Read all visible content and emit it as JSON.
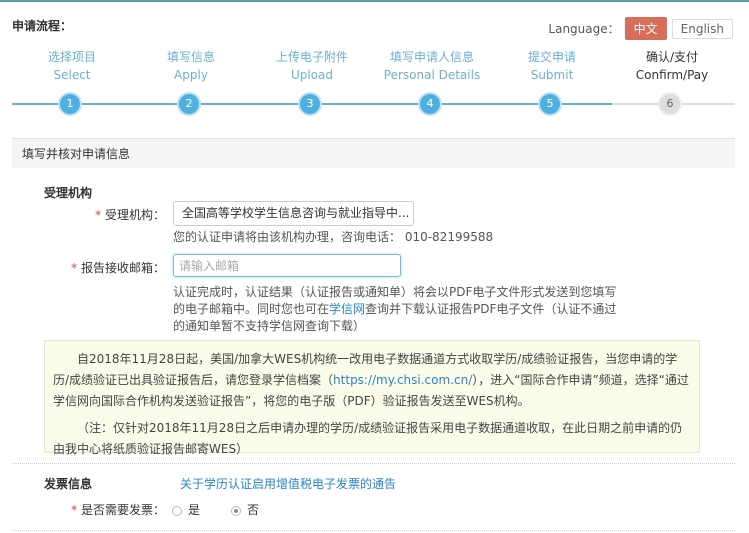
{
  "header": {
    "title": "申请流程：",
    "language_label": "Language：",
    "lang_zh": "中文",
    "lang_en": "English"
  },
  "steps": [
    {
      "zh": "选择项目",
      "en": "Select",
      "num": "1"
    },
    {
      "zh": "填写信息",
      "en": "Apply",
      "num": "2"
    },
    {
      "zh": "上传电子附件",
      "en": "Upload",
      "num": "3"
    },
    {
      "zh": "填写申请人信息",
      "en": "Personal Details",
      "num": "4"
    },
    {
      "zh": "提交申请",
      "en": "Submit",
      "num": "5"
    },
    {
      "zh": "确认/支付",
      "en": "Confirm/Pay",
      "num": "6"
    }
  ],
  "section_title": "填写并核对申请信息",
  "agency": {
    "heading": "受理机构",
    "label": "受理机构：",
    "value": "全国高等学校学生信息咨询与就业指导中...",
    "help": "您的认证申请将由该机构办理，咨询电话： 010-82199588"
  },
  "email": {
    "label": "报告接收邮箱：",
    "placeholder": "请输入邮箱",
    "help_a": "认证完成时，认证结果（认证报告或通知单）将会以PDF电子文件形式发送到您填写的电子邮箱中。同时您也可在",
    "help_link": "学信网",
    "help_b": "查询并下载认证报告PDF电子文件（认证不通过的通知单暂不支持学信网查询下载）"
  },
  "notice": {
    "p1_a": "自2018年11月28日起，美国/加拿大WES机构统一改用电子数据通道方式收取学历/成绩验证报告，当您申请的学历/成绩验证已出具验证报告后，请您登录学信档案（",
    "p1_link": "https://my.chsi.com.cn/",
    "p1_b": "），进入“国际合作申请”频道，选择“通过学信网向国际合作机构发送验证报告”，将您的电子版（PDF）验证报告发送至WES机构。",
    "p2": "（注：仅针对2018年11月28日之后申请办理的学历/成绩验证报告采用电子数据通道收取，在此日期之前申请的仍由我中心将纸质验证报告邮寄WES）"
  },
  "invoice": {
    "heading": "发票信息",
    "link": "关于学历认证启用增值税电子发票的通告",
    "label": "是否需要发票：",
    "yes": "是",
    "no": "否",
    "selected": "否"
  },
  "required_mark": "*"
}
